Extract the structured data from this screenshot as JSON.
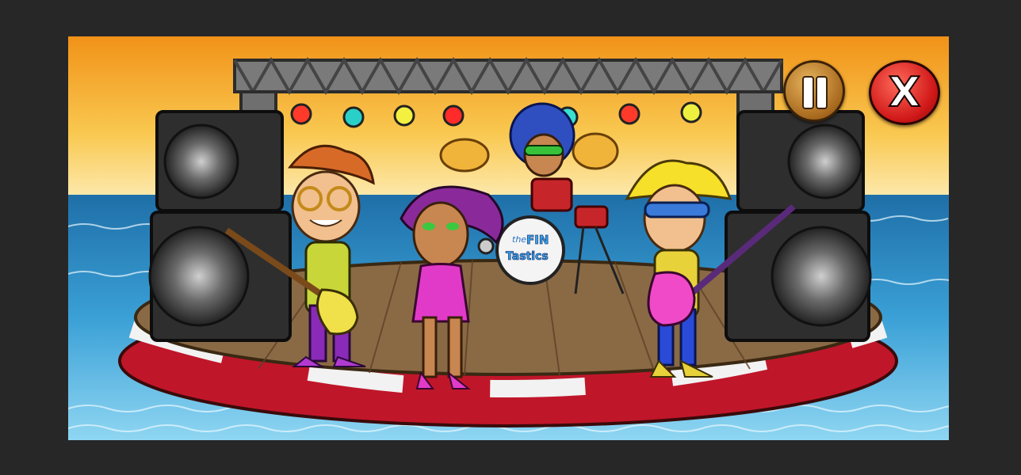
{
  "game": {
    "controls": {
      "pause_glyph": "",
      "close_glyph": "X"
    },
    "drum_logo": {
      "line1": "the",
      "line2": "FIN",
      "line3": "Tastics"
    },
    "colors": {
      "sky_top": "#f3a21c",
      "sky_bottom": "#fde7a0",
      "sea": "#2f8fc4",
      "stage_wood": "#8a6a45",
      "stage_rim_red": "#c0162a",
      "stage_rim_white": "#f2f2f2"
    }
  }
}
